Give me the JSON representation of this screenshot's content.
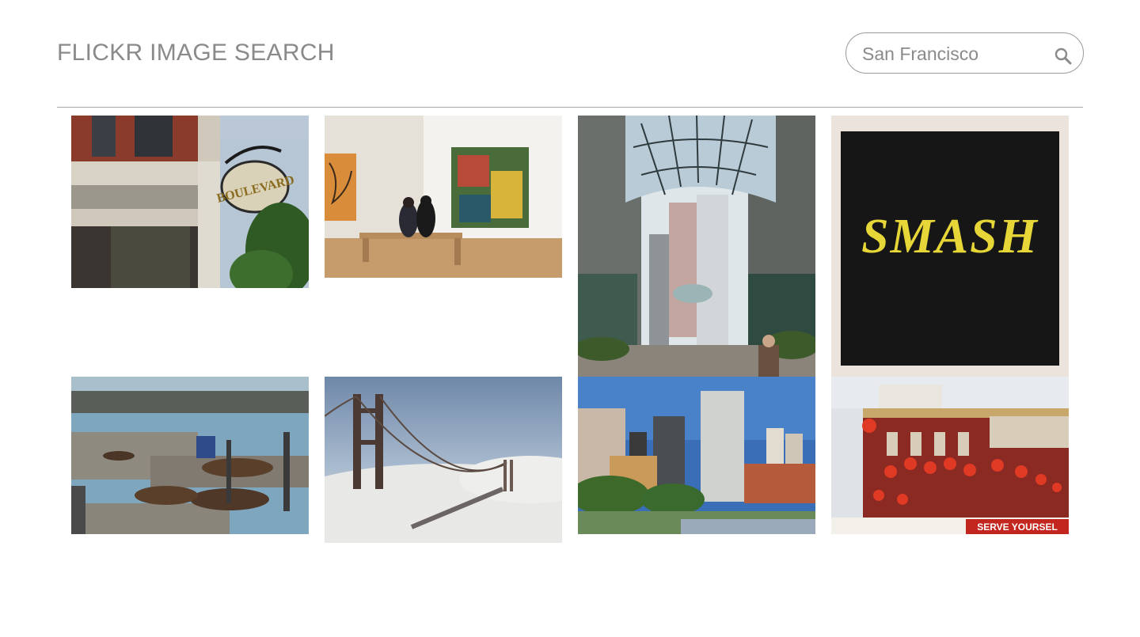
{
  "header": {
    "title": "FLICKR IMAGE SEARCH"
  },
  "search": {
    "value": "San Francisco",
    "icon": "search-icon"
  },
  "colors": {
    "title": "#8a8a8a",
    "divider": "#a8a8a8",
    "search_border": "#9a9a9a"
  },
  "photos": [
    {
      "name": "boulevard-restaurant",
      "sign_text": "BOULEVARD"
    },
    {
      "name": "museum-gallery-visitors"
    },
    {
      "name": "glass-arcade-street"
    },
    {
      "name": "smash-painting",
      "painting_text": "SMASH"
    },
    {
      "name": "pier-39-sea-lions"
    },
    {
      "name": "golden-gate-bridge-fog"
    },
    {
      "name": "downtown-skyline"
    },
    {
      "name": "chinatown-lanterns",
      "sign_text": "SERVE YOURSEL"
    }
  ]
}
